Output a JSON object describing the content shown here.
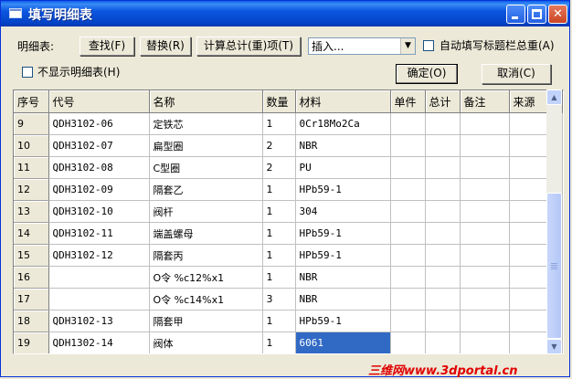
{
  "window": {
    "title": "填写明细表"
  },
  "toolbar": {
    "detail_label": "明细表:",
    "find_label": "查找(F)",
    "replace_label": "替换(R)",
    "calc_label": "计算总计(重)项(T)",
    "insert_value": "插入...",
    "auto_fill_label": "自动填写标题栏总重(A)",
    "hide_label": "不显示明细表(H)",
    "ok_label": "确定(O)",
    "cancel_label": "取消(C)"
  },
  "table": {
    "headers": [
      "序号",
      "代号",
      "名称",
      "数量",
      "材料",
      "单件",
      "总计",
      "备注",
      "来源"
    ],
    "rows": [
      [
        "9",
        "QDH3102-06",
        "定铁芯",
        "1",
        "0Cr18Mo2Ca",
        "",
        "",
        "",
        ""
      ],
      [
        "10",
        "QDH3102-07",
        "扁型圈",
        "2",
        "NBR",
        "",
        "",
        "",
        ""
      ],
      [
        "11",
        "QDH3102-08",
        "C型圈",
        "2",
        "PU",
        "",
        "",
        "",
        ""
      ],
      [
        "12",
        "QDH3102-09",
        "隔套乙",
        "1",
        "HPb59-1",
        "",
        "",
        "",
        ""
      ],
      [
        "13",
        "QDH3102-10",
        "阀杆",
        "1",
        "304",
        "",
        "",
        "",
        ""
      ],
      [
        "14",
        "QDH3102-11",
        "端盖螺母",
        "1",
        "HPb59-1",
        "",
        "",
        "",
        ""
      ],
      [
        "15",
        "QDH3102-12",
        "隔套丙",
        "1",
        "HPb59-1",
        "",
        "",
        "",
        ""
      ],
      [
        "16",
        "",
        "O令  %c12%x1",
        "1",
        "NBR",
        "",
        "",
        "",
        ""
      ],
      [
        "17",
        "",
        "O令  %c14%x1",
        "3",
        "NBR",
        "",
        "",
        "",
        ""
      ],
      [
        "18",
        "QDH3102-13",
        "隔套甲",
        "1",
        "HPb59-1",
        "",
        "",
        "",
        ""
      ],
      [
        "19",
        "QDH1302-14",
        "阀体",
        "1",
        "6061",
        "",
        "",
        "",
        ""
      ]
    ],
    "selected": {
      "row": 10,
      "col": 4
    }
  },
  "watermark": "三维网www.3dportal.cn",
  "colors": {
    "titlebar": "#0b56e0",
    "selection": "#316ac5",
    "watermark": "#e00000"
  }
}
